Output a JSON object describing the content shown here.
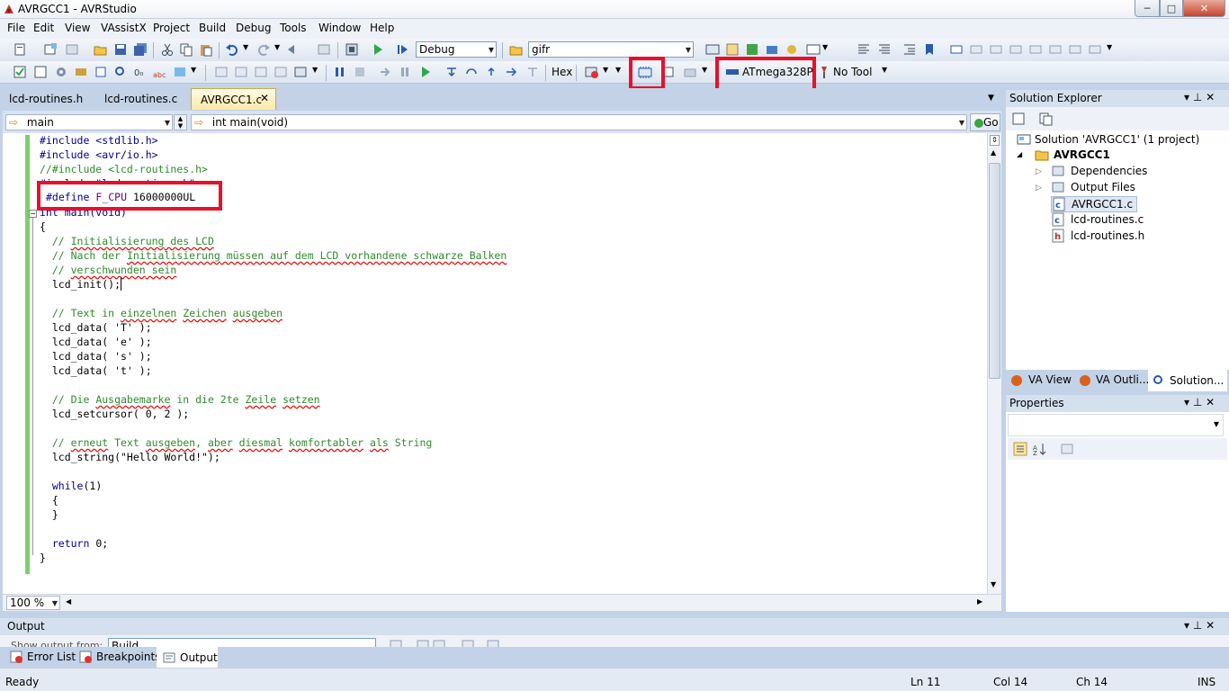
{
  "window": {
    "title": "AVRGCC1 - AVRStudio",
    "min": "─",
    "max": "□",
    "close": "✕"
  },
  "menu": [
    "File",
    "Edit",
    "View",
    "VAssistX",
    "Project",
    "Build",
    "Debug",
    "Tools",
    "Window",
    "Help"
  ],
  "toolbar1": {
    "config": "Debug",
    "find": "gifr"
  },
  "toolbar2": {
    "hex": "Hex",
    "device": "ATmega328P",
    "tool": "No Tool"
  },
  "tabs": [
    "lcd-routines.h",
    "lcd-routines.c",
    "AVRGCC1.c"
  ],
  "tab_close": "✕",
  "nav": {
    "scope": "main",
    "member": "int main(void)",
    "go": "Go"
  },
  "code": {
    "l1": "#include <stdlib.h>",
    "l2": "#include <avr/io.h>",
    "l3": "//#include <lcd-routines.h>",
    "l4": "#include \"lcd-routines.h\"",
    "l5_kw": "#define",
    "l5_name": "F_CPU",
    "l5_val": "16000000UL",
    "l6": "int main(void)",
    "l7": "{",
    "c1a": "  // ",
    "c1b": "Initialisierung",
    "c1c": " des LCD",
    "c2a": "  // Nach der ",
    "c2b": "Initialisierung",
    "c2c": " müssen auf dem LCD vorhandene schwarze Balken",
    "c3a": "  // ",
    "c3b": "verschwunden",
    "c3c": " sein",
    "l8": "  lcd_init();",
    "c4a": "  // Text in ",
    "c4b": "einzelnen",
    "c4c": " ",
    "c4d": "Zeichen",
    "c4e": " ",
    "c4f": "ausgeben",
    "d1": "  lcd_data( 'T' );",
    "d2": "  lcd_data( 'e' );",
    "d3": "  lcd_data( 's' );",
    "d4": "  lcd_data( 't' );",
    "c5a": "  // Die ",
    "c5b": "Ausgabemarke",
    "c5c": " in die 2te ",
    "c5d": "Zeile",
    "c5e": " ",
    "c5f": "setzen",
    "l9": "  lcd_setcursor( 0, 2 );",
    "c6a": "  // ",
    "c6b": "erneut",
    "c6c": " Text ",
    "c6d": "ausgeben",
    "c6e": ", ",
    "c6f": "aber",
    "c6g": " ",
    "c6h": "diesmal",
    "c6i": " ",
    "c6j": "komfortabler",
    "c6k": " ",
    "c6l": "als",
    "c6m": " String",
    "l10": "  lcd_string(\"Hello World!\");",
    "l11_kw": "  while",
    "l11_rest": "(1)",
    "l12": "  {",
    "l13": "  }",
    "l14_kw": "  return",
    "l14_rest": " 0;",
    "l15": "}"
  },
  "zoom": "100 %",
  "solution": {
    "header": "Solution Explorer",
    "root": "Solution 'AVRGCC1' (1 project)",
    "project": "AVRGCC1",
    "items": [
      "Dependencies",
      "Output Files",
      "AVRGCC1.c",
      "lcd-routines.c",
      "lcd-routines.h"
    ],
    "tabs": [
      "VA View",
      "VA Outli...",
      "Solution..."
    ]
  },
  "properties": {
    "header": "Properties"
  },
  "output": {
    "header": "Output",
    "show_label": "Show output from:",
    "source": "Build",
    "tabs": [
      "Error List",
      "Breakpoints",
      "Output"
    ]
  },
  "panel_glyphs": {
    "pin": "▾ ⊥ ✕"
  },
  "status": {
    "ready": "Ready",
    "ln": "Ln 11",
    "col": "Col 14",
    "ch": "Ch 14",
    "ins": "INS"
  },
  "colors": {
    "accent": "#e8102a",
    "bg": "#c3d2e6",
    "comment": "#2e8b2e",
    "keyword": "#00008b"
  }
}
